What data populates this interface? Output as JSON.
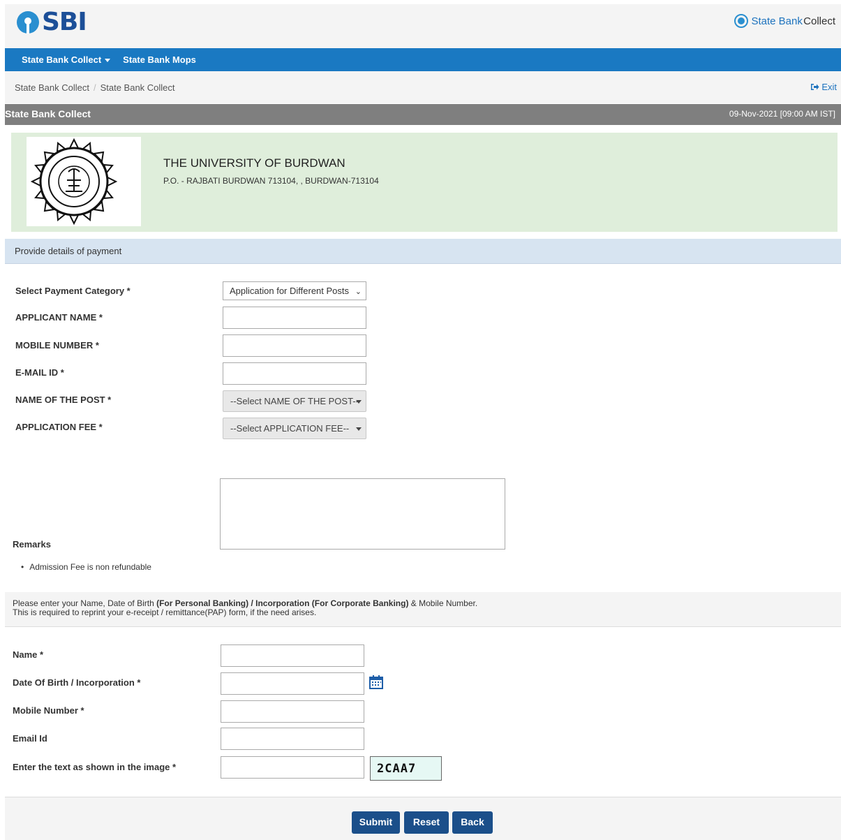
{
  "header": {
    "logo_text": "SBI",
    "brand_prefix": "State Bank ",
    "brand_suffix": "Collect"
  },
  "nav": {
    "items": [
      "State Bank Collect",
      "State Bank Mops"
    ]
  },
  "breadcrumb": [
    "State Bank Collect",
    "State Bank Collect"
  ],
  "exit_label": "Exit",
  "title_bar": {
    "title": "State Bank Collect",
    "datetime": "09-Nov-2021 [09:00 AM IST]"
  },
  "institution": {
    "name": "THE UNIVERSITY OF BURDWAN",
    "address": "P.O. - RAJBATI BURDWAN 713104, , BURDWAN-713104"
  },
  "payment_section": {
    "heading": "Provide details of payment",
    "fields": {
      "category_label": "Select Payment Category *",
      "category_value": "Application for Different Posts",
      "applicant_name_label": "APPLICANT NAME *",
      "mobile_label": "MOBILE NUMBER *",
      "email_label": "E-MAIL ID *",
      "post_label": "NAME OF THE POST *",
      "post_value": "--Select NAME OF THE POST--",
      "fee_label": "APPLICATION FEE *",
      "fee_value": "--Select APPLICATION FEE--",
      "remarks_label": "Remarks"
    },
    "note": "Admission Fee is non refundable"
  },
  "reprint_info": {
    "line1_a": "Please enter your Name, Date of Birth ",
    "line1_b": "(For Personal Banking) / Incorporation (For Corporate Banking)",
    "line1_c": " & Mobile Number.",
    "line2": "This is required to reprint your e-receipt / remittance(PAP) form, if the need arises."
  },
  "personal_section": {
    "name_label": "Name *",
    "dob_label": "Date Of Birth / Incorporation *",
    "mobile_label": "Mobile Number *",
    "email_label": "Email Id",
    "captcha_label": "Enter the text as shown in the image *",
    "captcha_text": "2CAA7"
  },
  "buttons": {
    "submit": "Submit",
    "reset": "Reset",
    "back": "Back"
  }
}
